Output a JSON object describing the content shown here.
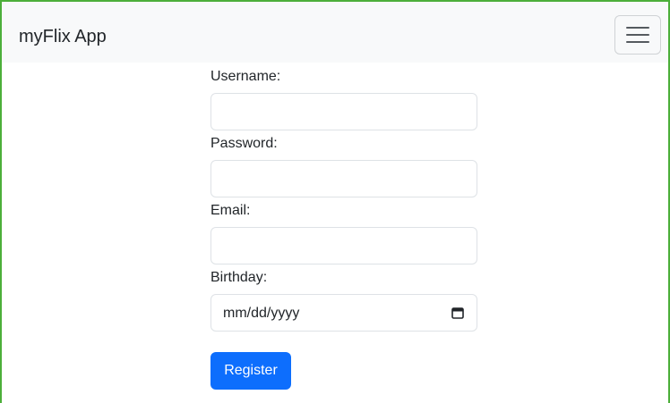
{
  "navbar": {
    "brand": "myFlix App"
  },
  "form": {
    "username_label": "Username:",
    "username_value": "",
    "password_label": "Password:",
    "password_value": "",
    "email_label": "Email:",
    "email_value": "",
    "birthday_label": "Birthday:",
    "birthday_placeholder": "mm/dd/yyyy",
    "register_label": "Register"
  },
  "icons": {
    "menu": "hamburger-menu-icon",
    "calendar": "calendar-icon"
  },
  "colors": {
    "primary": "#0d6efd",
    "navbar_bg": "#f8f9fa",
    "frame_border": "#4caf3a"
  }
}
